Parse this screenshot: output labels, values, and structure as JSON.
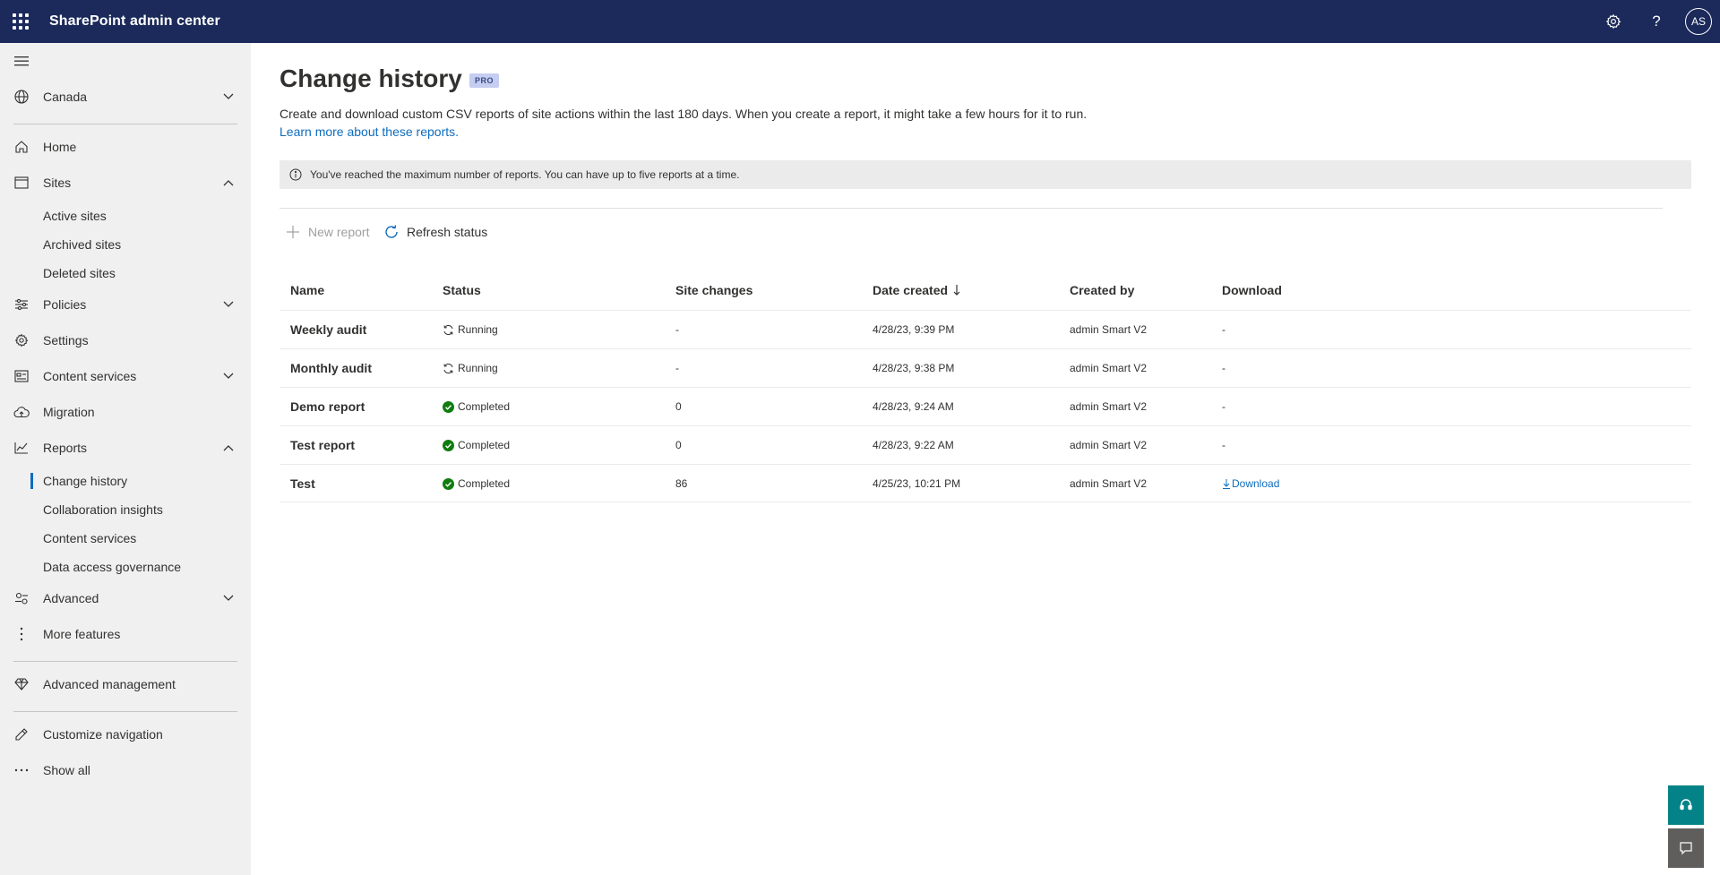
{
  "topbar": {
    "app_title": "SharePoint admin center",
    "avatar_initials": "AS"
  },
  "sidebar": {
    "geo": "Canada",
    "items": {
      "home": "Home",
      "sites": "Sites",
      "active_sites": "Active sites",
      "archived_sites": "Archived sites",
      "deleted_sites": "Deleted sites",
      "policies": "Policies",
      "settings": "Settings",
      "content_services": "Content services",
      "migration": "Migration",
      "reports": "Reports",
      "change_history": "Change history",
      "collaboration_insights": "Collaboration insights",
      "content_services_report": "Content services",
      "data_access_governance": "Data access governance",
      "advanced": "Advanced",
      "more_features": "More features",
      "advanced_management": "Advanced management",
      "customize_navigation": "Customize navigation",
      "show_all": "Show all"
    }
  },
  "page": {
    "title": "Change history",
    "badge": "PRO",
    "description": "Create and download custom CSV reports of site actions within the last 180 days. When you create a report, it might take a few hours for it to run.",
    "learn_more": "Learn more about these reports.",
    "banner": "You've reached the maximum number of reports. You can have up to five reports at a time."
  },
  "commands": {
    "new_report": "New report",
    "refresh_status": "Refresh status"
  },
  "table": {
    "columns": {
      "name": "Name",
      "status": "Status",
      "site_changes": "Site changes",
      "date_created": "Date created",
      "created_by": "Created by",
      "download": "Download"
    },
    "rows": [
      {
        "name": "Weekly audit",
        "status": "Running",
        "status_kind": "running",
        "site_changes": "-",
        "date_created": "4/28/23, 9:39 PM",
        "created_by": "admin Smart V2",
        "download": "-"
      },
      {
        "name": "Monthly audit",
        "status": "Running",
        "status_kind": "running",
        "site_changes": "-",
        "date_created": "4/28/23, 9:38 PM",
        "created_by": "admin Smart V2",
        "download": "-"
      },
      {
        "name": "Demo report",
        "status": "Completed",
        "status_kind": "completed",
        "site_changes": "0",
        "date_created": "4/28/23, 9:24 AM",
        "created_by": "admin Smart V2",
        "download": "-"
      },
      {
        "name": "Test report",
        "status": "Completed",
        "status_kind": "completed",
        "site_changes": "0",
        "date_created": "4/28/23, 9:22 AM",
        "created_by": "admin Smart V2",
        "download": "-"
      },
      {
        "name": "Test",
        "status": "Completed",
        "status_kind": "completed",
        "site_changes": "86",
        "date_created": "4/25/23, 10:21 PM",
        "created_by": "admin Smart V2",
        "download": "Download"
      }
    ]
  },
  "colors": {
    "topbar": "#1b2a5b",
    "accent": "#0f6cbd",
    "completed": "#107c10",
    "help_fab": "#038387"
  }
}
